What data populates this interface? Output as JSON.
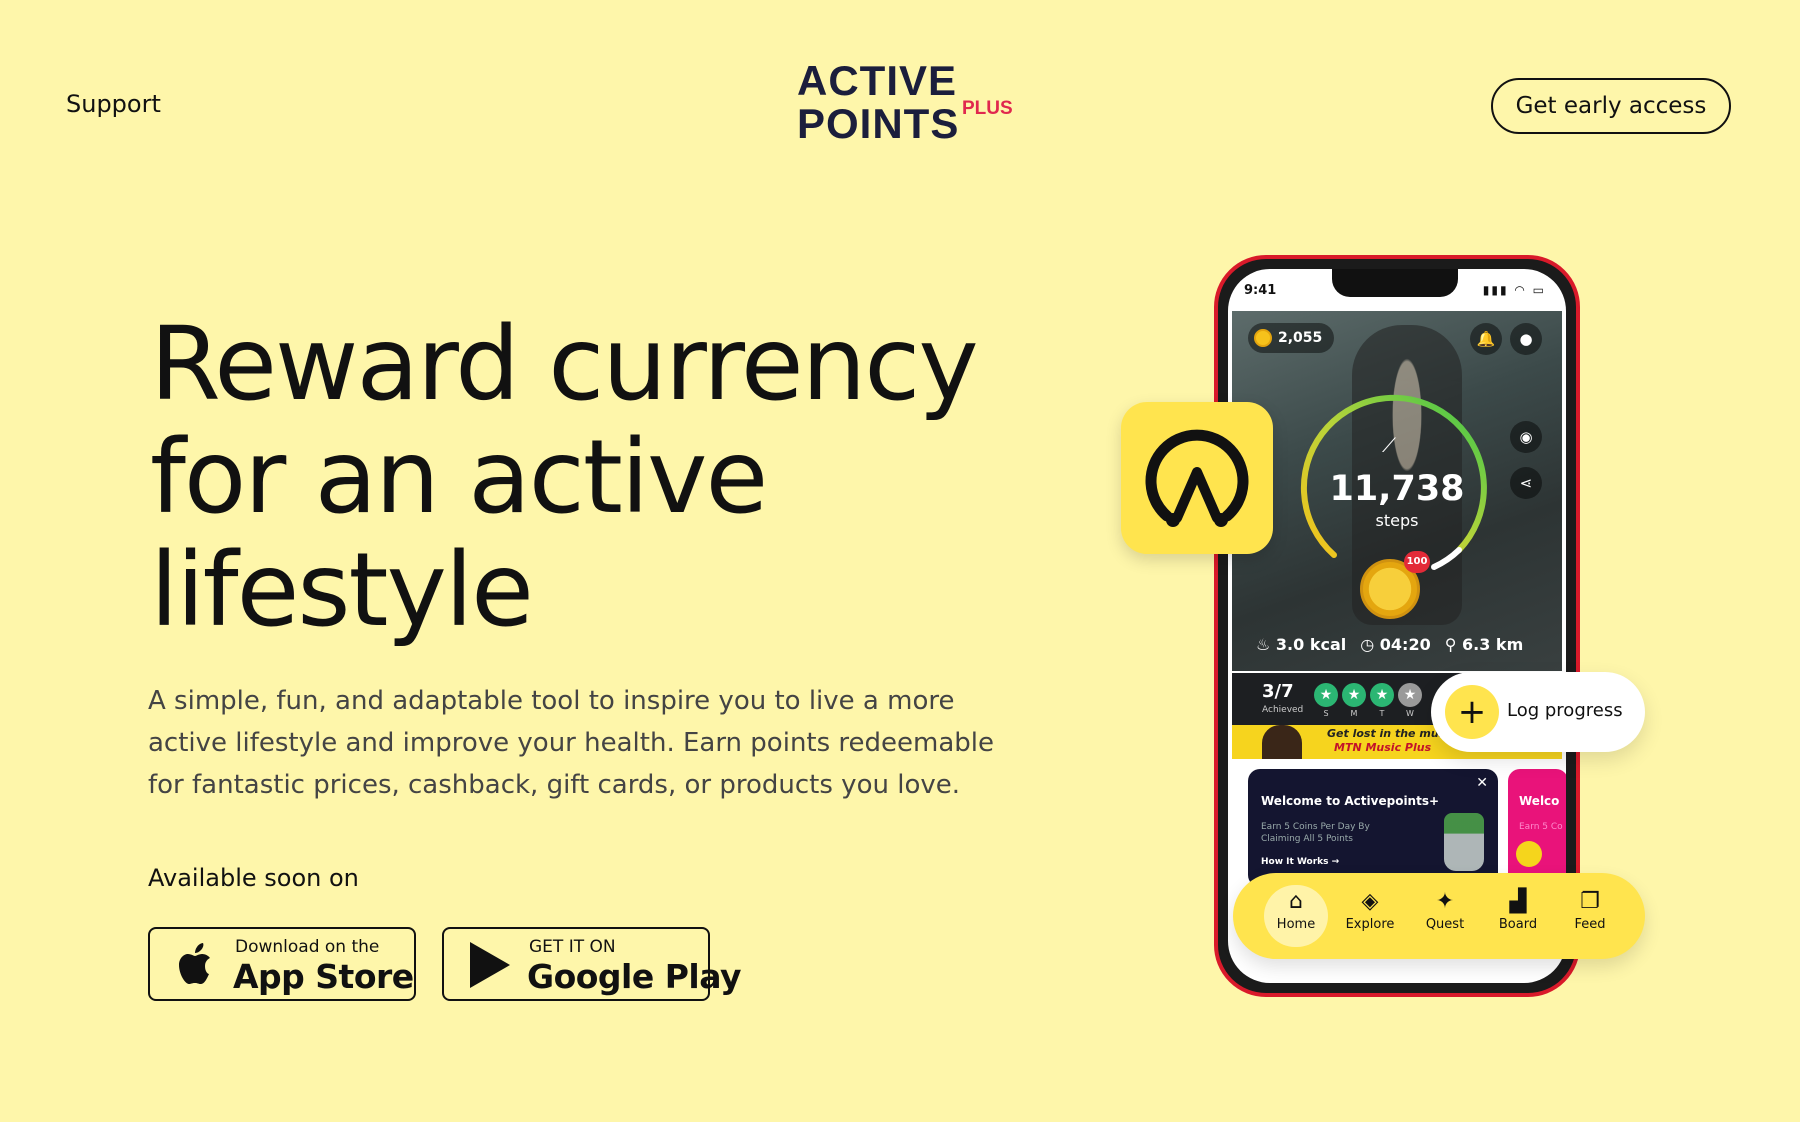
{
  "header": {
    "support_link": "Support",
    "logo_line1": "ACTIVE",
    "logo_line2": "POINTS",
    "logo_plus": "PLUS",
    "cta_label": "Get early access"
  },
  "hero": {
    "title_line1": "Reward currency",
    "title_line2": "for an active",
    "title_line3": "lifestyle",
    "description": "A simple, fun, and adaptable tool to inspire you to live a more active lifestyle and improve your health. Earn points redeemable for fantastic prices, cashback, gift cards, or products you love.",
    "available_label": "Available soon on"
  },
  "stores": {
    "apple_small": "Download on the",
    "apple_big": "App Store",
    "google_small": "GET IT ON",
    "google_big": "Google Play"
  },
  "phone": {
    "status_time": "9:41",
    "coins": "2,055",
    "steps": "11,738",
    "steps_label": "steps",
    "badge": "100",
    "kcal": "3.0 kcal",
    "time": "04:20",
    "distance": "6.3 km",
    "achieved_fraction": "3/7",
    "achieved_label": "Achieved",
    "days": [
      "S",
      "M",
      "T",
      "W"
    ],
    "banner_line1": "Get lost in the music.",
    "banner_line2": "MTN Music Plus",
    "card1_title": "Welcome to Activepoints+",
    "card1_desc": "Earn 5 Coins Per Day By Claiming All 5 Points",
    "card1_link": "How It Works",
    "card2_title": "Welco",
    "card2_desc": "Earn 5 Co"
  },
  "floating": {
    "log_progress": "Log progress"
  },
  "bottom_nav": {
    "items": [
      {
        "label": "Home",
        "icon": "home-icon"
      },
      {
        "label": "Explore",
        "icon": "compass-icon"
      },
      {
        "label": "Quest",
        "icon": "sparkle-icon"
      },
      {
        "label": "Board",
        "icon": "podium-icon"
      },
      {
        "label": "Feed",
        "icon": "feed-icon"
      }
    ],
    "active": "Home"
  },
  "colors": {
    "background": "#FEF6AA",
    "brand_yellow": "#FFE44E",
    "brand_navy": "#1B1E3C",
    "brand_red": "#E0284E"
  }
}
